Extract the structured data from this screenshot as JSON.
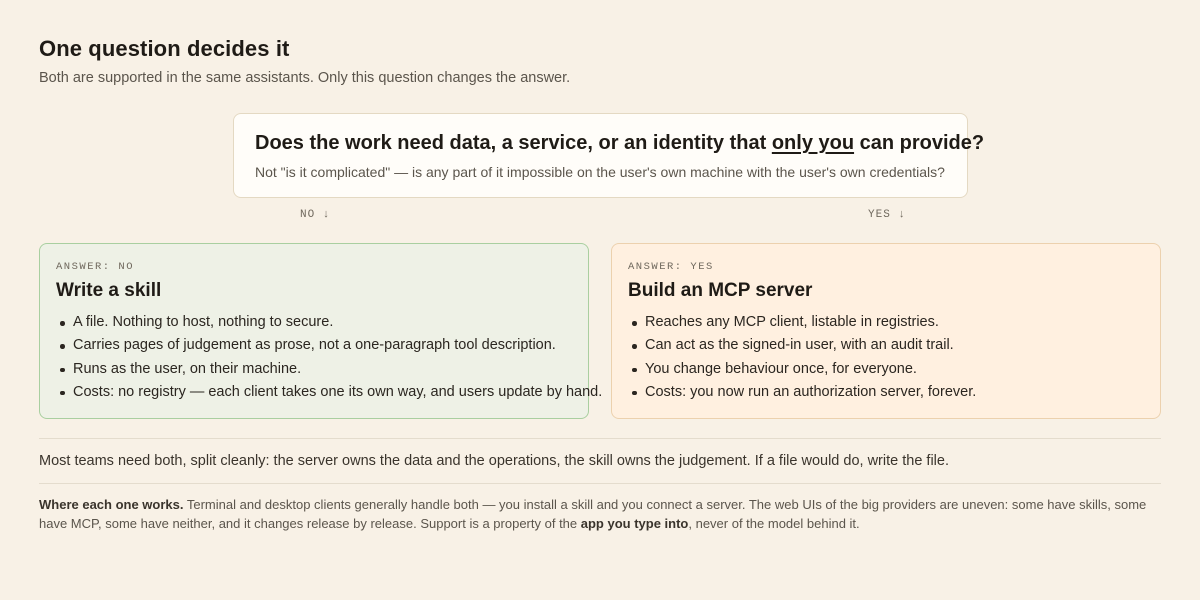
{
  "header": {
    "title": "One question decides it",
    "subtitle": "Both are supported in the same assistants. Only this question changes the answer."
  },
  "question": {
    "lead": "Does the work need data, a service, or an identity that ",
    "emphasis": "only you",
    "tail": " can provide?",
    "sub": "Not \"is it complicated\" — is any part of it impossible on the user's own machine with the user's own credentials?"
  },
  "branches": {
    "no_label": "NO ↓",
    "yes_label": "YES ↓"
  },
  "answers": {
    "no": {
      "tag": "ANSWER: NO",
      "title": "Write a skill",
      "points": [
        "A file. Nothing to host, nothing to secure.",
        "Carries pages of judgement as prose, not a one-paragraph tool description.",
        "Runs as the user, on their machine.",
        "Costs: no registry — each client takes one its own way, and users update by hand."
      ]
    },
    "yes": {
      "tag": "ANSWER: YES",
      "title": "Build an MCP server",
      "points": [
        "Reaches any MCP client, listable in registries.",
        "Can act as the signed-in user, with an audit trail.",
        "You change behaviour once, for everyone.",
        "Costs: you now run an authorization server, forever."
      ]
    }
  },
  "summary": "Most teams need both, split cleanly: the server owns the data and the operations, the skill owns the judgement. If a file would do, write the file.",
  "footnote": {
    "lead": "Where each one works.",
    "body": " Terminal and desktop clients generally handle both — you install a skill and you connect a server. The web UIs of the big providers are uneven: some have skills, some have MCP, some have neither, and it changes release by release. Support is a property of the ",
    "bold": "app you type into",
    "tail": ", never of the model behind it."
  },
  "colors": {
    "background": "#f8f1e6",
    "no_card_bg": "#eef1e6",
    "no_card_border": "#a9cfa0",
    "yes_card_bg": "#fff0e0",
    "yes_card_border": "#ecd1ae"
  }
}
